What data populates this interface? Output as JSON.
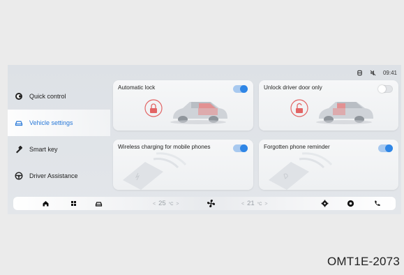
{
  "status": {
    "time": "09:41",
    "icons": [
      "seat-belt-icon",
      "mute-icon"
    ]
  },
  "sidebar": {
    "items": [
      {
        "label": "Quick control",
        "icon": "quick-control-icon",
        "active": false
      },
      {
        "label": "Vehicle settings",
        "icon": "vehicle-settings-icon",
        "active": true
      },
      {
        "label": "Smart key",
        "icon": "smart-key-icon",
        "active": false
      },
      {
        "label": "Driver Assistance",
        "icon": "driver-assistance-icon",
        "active": false
      }
    ]
  },
  "cards": {
    "automatic_lock": {
      "title": "Automatic lock",
      "toggle": "on"
    },
    "unlock_driver_door": {
      "title": "Unlock driver door only",
      "toggle": "off"
    },
    "wireless_charging": {
      "title": "Wireless charging for mobile phones",
      "toggle": "on"
    },
    "forgotten_phone": {
      "title": "Forgotten phone reminder",
      "toggle": "on"
    }
  },
  "dock": {
    "left_temp": "25",
    "right_temp": "21",
    "unit": "°C",
    "icons": [
      "home-icon",
      "apps-grid-icon",
      "car-icon",
      "fan-icon",
      "settings-icon",
      "music-icon",
      "phone-icon"
    ]
  },
  "colors": {
    "accent": "#2f86e6",
    "lock_red": "#e26464"
  },
  "caption": "OMT1E-2073"
}
